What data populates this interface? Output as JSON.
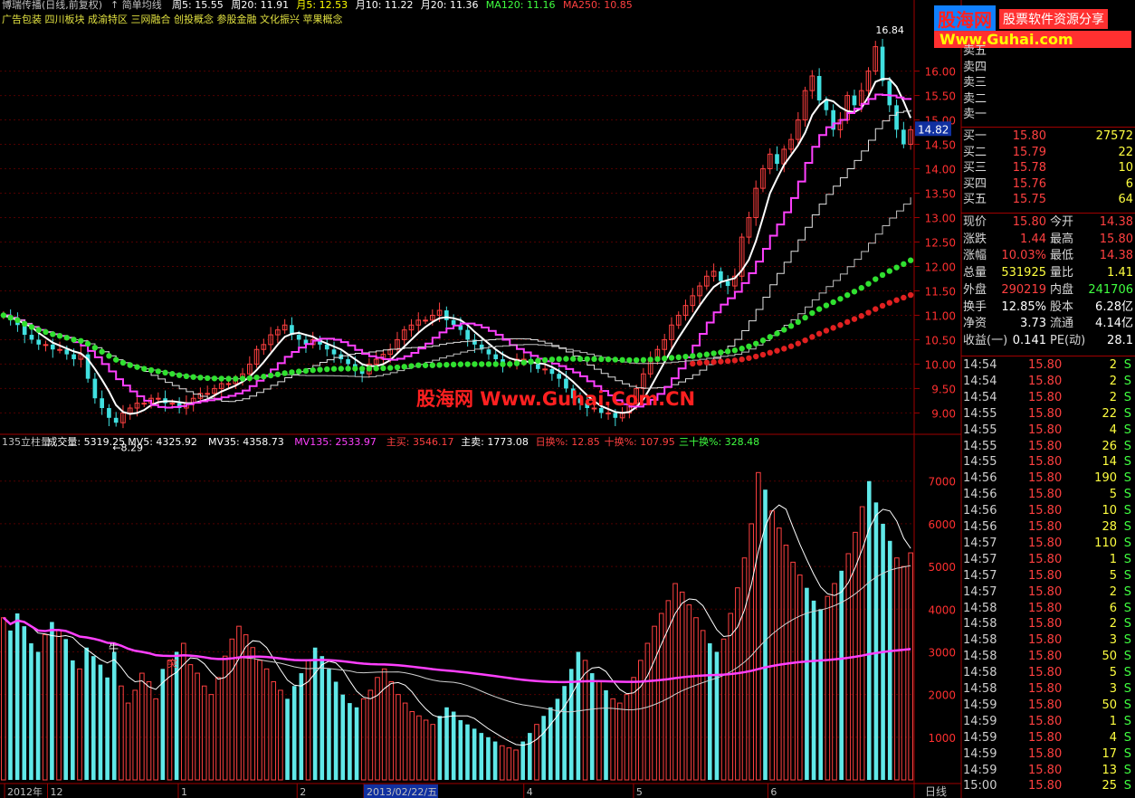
{
  "header": {
    "title": "博瑞传播(日线,前复权)",
    "ma_label": "简单均线",
    "ma": [
      {
        "label": "周5: 15.55",
        "color": "#ffffff"
      },
      {
        "label": "周20: 11.91",
        "color": "#ffffff"
      },
      {
        "label": "月5: 12.53",
        "color": "#ffff00"
      },
      {
        "label": "月10: 11.22",
        "color": "#ffffff"
      },
      {
        "label": "月20: 11.36",
        "color": "#ffffff"
      },
      {
        "label": "MA120: 11.16",
        "color": "#40ff40"
      },
      {
        "label": "MA250: 10.85",
        "color": "#ff4040"
      }
    ],
    "concepts": "广告包装 四川板块 成渝特区 三网融合 创投概念 参股金融 文化振兴 苹果概念"
  },
  "watermark": "股海网 Www.Guhai.Com.CN",
  "logo": {
    "name": "股海网",
    "slogan": "股票软件资源分享",
    "url": "Www.Guhai.com"
  },
  "volume_header": [
    {
      "label": "135立柱量",
      "color": "#c0c0c0"
    },
    {
      "label": "成交量: 5319.25",
      "color": "#ffffff"
    },
    {
      "label": "MV5: 4325.92",
      "color": "#ffffff"
    },
    {
      "label": "MV35: 4358.73",
      "color": "#ffffff"
    },
    {
      "label": "MV135: 2533.97",
      "color": "#ff40ff"
    },
    {
      "label": "主买: 3546.17",
      "color": "#ff4040"
    },
    {
      "label": "主卖: 1773.08",
      "color": "#ffffff"
    },
    {
      "label": "日换%: 12.85",
      "color": "#ff4040"
    },
    {
      "label": "十换%: 107.95",
      "color": "#ff4040"
    },
    {
      "label": "三十换%: 328.48",
      "color": "#40ff40"
    }
  ],
  "annotations": {
    "high": "16.84",
    "low": "8.29",
    "cross": "牛",
    "break": "突"
  },
  "current_price_tag": "14.82",
  "x_axis_labels": [
    {
      "text": "2012年",
      "pos": 0.005
    },
    {
      "text": "12",
      "pos": 0.052
    },
    {
      "text": "1",
      "pos": 0.195
    },
    {
      "text": "2",
      "pos": 0.325
    },
    {
      "text": "2013/02/22/五",
      "pos": 0.398
    },
    {
      "text": "4",
      "pos": 0.573
    },
    {
      "text": "5",
      "pos": 0.693
    },
    {
      "text": "6",
      "pos": 0.84
    }
  ],
  "period_label": "日线",
  "chart_data": {
    "type": "candlestick",
    "price_axis": {
      "ylim": [
        8.6,
        16.9
      ],
      "ticks": [
        "9.00",
        "9.50",
        "10.00",
        "10.50",
        "11.00",
        "11.50",
        "12.00",
        "12.50",
        "13.00",
        "13.50",
        "14.00",
        "14.50",
        "15.00",
        "15.50",
        "16.00"
      ]
    },
    "volume_axis": {
      "ylim": [
        0,
        7800
      ],
      "ticks": [
        "1000",
        "2000",
        "3000",
        "4000",
        "5000",
        "6000",
        "7000"
      ]
    },
    "closes": [
      11.0,
      10.9,
      10.8,
      10.6,
      10.5,
      10.4,
      10.4,
      10.3,
      10.3,
      10.2,
      10.1,
      10.2,
      9.7,
      9.3,
      9.1,
      8.9,
      8.8,
      9.0,
      9.1,
      9.2,
      9.2,
      9.3,
      9.3,
      9.2,
      9.2,
      9.1,
      9.2,
      9.3,
      9.4,
      9.4,
      9.5,
      9.6,
      9.6,
      9.7,
      9.8,
      10.0,
      10.3,
      10.4,
      10.6,
      10.7,
      10.8,
      10.6,
      10.5,
      10.4,
      10.5,
      10.4,
      10.3,
      10.2,
      10.1,
      10.0,
      9.9,
      9.8,
      10.0,
      10.1,
      10.2,
      10.3,
      10.5,
      10.7,
      10.8,
      10.9,
      10.9,
      11.0,
      11.1,
      10.9,
      10.8,
      10.7,
      10.5,
      10.4,
      10.3,
      10.2,
      10.1,
      10.0,
      10.0,
      10.1,
      10.1,
      10.0,
      9.9,
      9.9,
      9.8,
      9.7,
      9.5,
      9.3,
      9.2,
      9.1,
      9.1,
      9.0,
      9.0,
      8.9,
      9.0,
      9.2,
      9.5,
      9.8,
      10.1,
      10.3,
      10.5,
      10.8,
      11.0,
      11.2,
      11.4,
      11.6,
      11.8,
      11.9,
      11.7,
      11.6,
      11.8,
      12.6,
      13.0,
      13.6,
      14.0,
      14.3,
      14.1,
      14.4,
      14.6,
      15.0,
      15.6,
      15.9,
      15.4,
      15.2,
      14.8,
      15.0,
      15.5,
      15.3,
      15.6,
      16.0,
      16.5,
      15.8,
      15.3,
      14.8,
      14.5,
      14.8
    ],
    "ma_lines": [
      "周5",
      "周20",
      "月5",
      "月10",
      "月20",
      "MA120",
      "MA250"
    ],
    "volumes": [
      3800,
      3500,
      3900,
      3600,
      3200,
      3000,
      3400,
      3700,
      3500,
      3300,
      2800,
      2600,
      3100,
      2900,
      2700,
      2400,
      3000,
      2200,
      1800,
      2100,
      2500,
      2300,
      1900,
      2600,
      2800,
      3000,
      3200,
      2700,
      2500,
      2200,
      2000,
      2400,
      2900,
      3300,
      3600,
      3400,
      3100,
      2800,
      2600,
      2300,
      2100,
      1900,
      2200,
      2500,
      2800,
      3100,
      2900,
      2600,
      2300,
      2000,
      1800,
      1700,
      1900,
      2100,
      2400,
      2600,
      2300,
      2000,
      1800,
      1600,
      1500,
      1400,
      1300,
      1500,
      1700,
      1600,
      1400,
      1300,
      1200,
      1100,
      1000,
      900,
      800,
      750,
      700,
      900,
      1100,
      1300,
      1500,
      1700,
      1900,
      2200,
      2600,
      3000,
      2800,
      2500,
      2300,
      2100,
      1900,
      1800,
      2000,
      2400,
      2800,
      3200,
      3600,
      3900,
      4200,
      4600,
      4400,
      4100,
      3800,
      3500,
      3200,
      3000,
      3300,
      3900,
      4500,
      5200,
      6000,
      7200,
      6800,
      6300,
      5900,
      5500,
      5100,
      4800,
      4500,
      4200,
      4000,
      4300,
      4600,
      4900,
      5300,
      5800,
      6400,
      7000,
      6500,
      6000,
      5600,
      5200,
      5000,
      5319
    ],
    "ylabel_price": "",
    "ylabel_volume": ""
  },
  "quote": {
    "sell": [
      {
        "label": "卖五",
        "price": "",
        "vol": ""
      },
      {
        "label": "卖四",
        "price": "",
        "vol": ""
      },
      {
        "label": "卖三",
        "price": "",
        "vol": ""
      },
      {
        "label": "卖二",
        "price": "",
        "vol": ""
      },
      {
        "label": "卖一",
        "price": "",
        "vol": ""
      }
    ],
    "buy": [
      {
        "label": "买一",
        "price": "15.80",
        "vol": "27572"
      },
      {
        "label": "买二",
        "price": "15.79",
        "vol": "22"
      },
      {
        "label": "买三",
        "price": "15.78",
        "vol": "10"
      },
      {
        "label": "买四",
        "price": "15.76",
        "vol": "6"
      },
      {
        "label": "买五",
        "price": "15.75",
        "vol": "64"
      }
    ],
    "stats": [
      {
        "l1": "现价",
        "v1": "15.80",
        "c1": "#ff4040",
        "l2": "今开",
        "v2": "14.38",
        "c2": "#ff4040"
      },
      {
        "l1": "涨跌",
        "v1": "1.44",
        "c1": "#ff4040",
        "l2": "最高",
        "v2": "15.80",
        "c2": "#ff4040"
      },
      {
        "l1": "涨幅",
        "v1": "10.03%",
        "c1": "#ff4040",
        "l2": "最低",
        "v2": "14.38",
        "c2": "#ff4040"
      },
      {
        "l1": "总量",
        "v1": "531925",
        "c1": "#ffff40",
        "l2": "量比",
        "v2": "1.41",
        "c2": "#ffff40"
      },
      {
        "l1": "外盘",
        "v1": "290219",
        "c1": "#ff4040",
        "l2": "内盘",
        "v2": "241706",
        "c2": "#40ff40"
      },
      {
        "l1": "换手",
        "v1": "12.85%",
        "c1": "#ffffff",
        "l2": "股本",
        "v2": "6.28亿",
        "c2": "#ffffff"
      },
      {
        "l1": "净资",
        "v1": "3.73",
        "c1": "#ffffff",
        "l2": "流通",
        "v2": "4.14亿",
        "c2": "#ffffff"
      },
      {
        "l1": "收益(一)",
        "v1": "0.141",
        "c1": "#ffffff",
        "l2": "PE(动)",
        "v2": "28.1",
        "c2": "#ffffff"
      }
    ],
    "ticks": [
      {
        "time": "14:54",
        "price": "15.80",
        "vol": "2",
        "bs": "S"
      },
      {
        "time": "14:54",
        "price": "15.80",
        "vol": "2",
        "bs": "S"
      },
      {
        "time": "14:54",
        "price": "15.80",
        "vol": "2",
        "bs": "S"
      },
      {
        "time": "14:55",
        "price": "15.80",
        "vol": "22",
        "bs": "S"
      },
      {
        "time": "14:55",
        "price": "15.80",
        "vol": "4",
        "bs": "S"
      },
      {
        "time": "14:55",
        "price": "15.80",
        "vol": "26",
        "bs": "S"
      },
      {
        "time": "14:55",
        "price": "15.80",
        "vol": "14",
        "bs": "S"
      },
      {
        "time": "14:56",
        "price": "15.80",
        "vol": "190",
        "bs": "S"
      },
      {
        "time": "14:56",
        "price": "15.80",
        "vol": "5",
        "bs": "S"
      },
      {
        "time": "14:56",
        "price": "15.80",
        "vol": "10",
        "bs": "S"
      },
      {
        "time": "14:56",
        "price": "15.80",
        "vol": "28",
        "bs": "S"
      },
      {
        "time": "14:57",
        "price": "15.80",
        "vol": "110",
        "bs": "S"
      },
      {
        "time": "14:57",
        "price": "15.80",
        "vol": "1",
        "bs": "S"
      },
      {
        "time": "14:57",
        "price": "15.80",
        "vol": "5",
        "bs": "S"
      },
      {
        "time": "14:57",
        "price": "15.80",
        "vol": "2",
        "bs": "S"
      },
      {
        "time": "14:58",
        "price": "15.80",
        "vol": "6",
        "bs": "S"
      },
      {
        "time": "14:58",
        "price": "15.80",
        "vol": "2",
        "bs": "S"
      },
      {
        "time": "14:58",
        "price": "15.80",
        "vol": "3",
        "bs": "S"
      },
      {
        "time": "14:58",
        "price": "15.80",
        "vol": "50",
        "bs": "S"
      },
      {
        "time": "14:58",
        "price": "15.80",
        "vol": "5",
        "bs": "S"
      },
      {
        "time": "14:58",
        "price": "15.80",
        "vol": "3",
        "bs": "S"
      },
      {
        "time": "14:59",
        "price": "15.80",
        "vol": "50",
        "bs": "S"
      },
      {
        "time": "14:59",
        "price": "15.80",
        "vol": "1",
        "bs": "S"
      },
      {
        "time": "14:59",
        "price": "15.80",
        "vol": "4",
        "bs": "S"
      },
      {
        "time": "14:59",
        "price": "15.80",
        "vol": "17",
        "bs": "S"
      },
      {
        "time": "14:59",
        "price": "15.80",
        "vol": "13",
        "bs": "S"
      },
      {
        "time": "15:00",
        "price": "15.80",
        "vol": "25",
        "bs": "S"
      }
    ]
  }
}
